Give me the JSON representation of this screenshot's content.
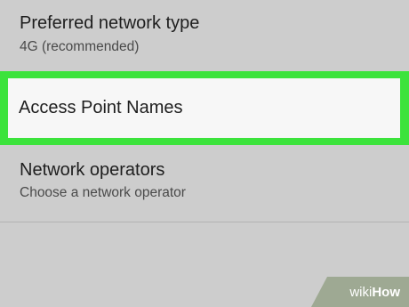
{
  "settings": {
    "preferred_network_type": {
      "title": "Preferred network type",
      "value": "4G (recommended)"
    },
    "access_point_names": {
      "title": "Access Point Names"
    },
    "network_operators": {
      "title": "Network operators",
      "subtitle": "Choose a network operator"
    }
  },
  "highlight_color": "#3ce33c",
  "watermark": {
    "wiki": "wiki",
    "how": "How"
  }
}
